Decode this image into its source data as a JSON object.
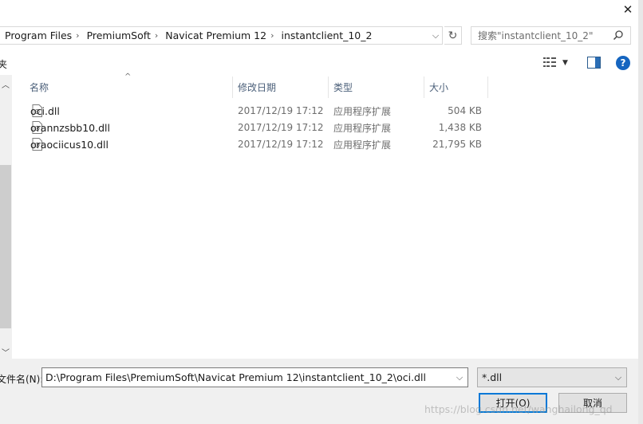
{
  "window": {
    "close_icon": "close-icon"
  },
  "address_bar": {
    "crumbs": [
      "Program Files",
      "PremiumSoft",
      "Navicat Premium 12",
      "instantclient_10_2"
    ],
    "dropdown_icon": "chevron-down-icon",
    "refresh_icon": "refresh-icon"
  },
  "search": {
    "placeholder": "搜索\"instantclient_10_2\"",
    "icon": "search-icon"
  },
  "toolbar": {
    "left_fragment": "夹",
    "view_icon": "view-options-icon",
    "preview_pane_icon": "preview-pane-icon",
    "help_label": "?"
  },
  "columns": {
    "name": "名称",
    "date": "修改日期",
    "type": "类型",
    "size": "大小"
  },
  "files": [
    {
      "name": "oci.dll",
      "date": "2017/12/19 17:12",
      "type": "应用程序扩展",
      "size": "504 KB"
    },
    {
      "name": "orannzsbb10.dll",
      "date": "2017/12/19 17:12",
      "type": "应用程序扩展",
      "size": "1,438 KB"
    },
    {
      "name": "oraociicus10.dll",
      "date": "2017/12/19 17:12",
      "type": "应用程序扩展",
      "size": "21,795 KB"
    }
  ],
  "footer": {
    "filename_label": "文件名(N):",
    "filename_value": "D:\\Program Files\\PremiumSoft\\Navicat Premium 12\\instantclient_10_2\\oci.dll",
    "filter_value": "*.dll",
    "open_label": "打开(O)",
    "cancel_label": "取消"
  },
  "watermark": "https://blog.csdn.net/wanghailong_qd"
}
